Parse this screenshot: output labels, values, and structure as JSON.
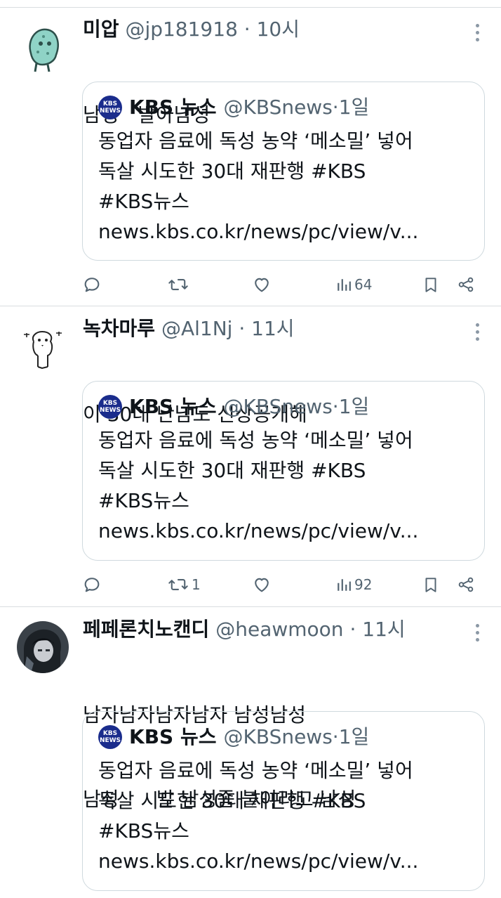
{
  "tweets": [
    {
      "display_name": "미압",
      "handle": "@jp181918",
      "time": "10시",
      "avatar_icon": "teal-character-avatar",
      "lines": [
        "남성   발아남성"
      ],
      "quote": {
        "name": "KBS 뉴스",
        "handle": "@KBSnews",
        "time": "1일",
        "lines": [
          "동업자 음료에 독성 농약 ‘메소밀’ 넣어",
          "독살 시도한 30대 재판행 #KBS",
          "#KBS뉴스",
          "news.kbs.co.kr/news/pc/view/v..."
        ]
      },
      "retweets": "",
      "views": "64"
    },
    {
      "display_name": "녹차마루",
      "handle": "@Al1Nj",
      "time": "11시",
      "avatar_icon": "sketch-dog-avatar",
      "lines": [
        "이 30대 난남도 신상공개해"
      ],
      "quote": {
        "name": "KBS 뉴스",
        "handle": "@KBSnews",
        "time": "1일",
        "lines": [
          "동업자 음료에 독성 농약 ‘메소밀’ 넣어",
          "독살 시도한 30대 재판행 #KBS",
          "#KBS뉴스",
          "news.kbs.co.kr/news/pc/view/v..."
        ]
      },
      "retweets": "1",
      "views": "92"
    },
    {
      "display_name": "페페론치노캔디",
      "handle": "@heawmoon",
      "time": "11시",
      "avatar_icon": "dark-portrait-avatar",
      "lines": [
        "남자남자남자남자 남성남성",
        "남성      발 남성좀 붙이라고 남성"
      ],
      "quote": {
        "name": "KBS 뉴스",
        "handle": "@KBSnews",
        "time": "1일",
        "lines": [
          "동업자 음료에 독성 농약 ‘메소밀’ 넣어",
          "독살 시도한 30대 재판행 #KBS",
          "#KBS뉴스",
          "news.kbs.co.kr/news/pc/view/v..."
        ]
      }
    }
  ],
  "kbs_logo": {
    "top": "KBS",
    "bottom": "NEWS"
  },
  "colors": {
    "text": "#0f1419",
    "meta": "#536471",
    "border": "#cfd9de",
    "kbs_blue": "#1a2c8c"
  },
  "action_icons": [
    "reply-icon",
    "retweet-icon",
    "like-icon",
    "views-icon",
    "bookmark-icon",
    "share-icon"
  ]
}
